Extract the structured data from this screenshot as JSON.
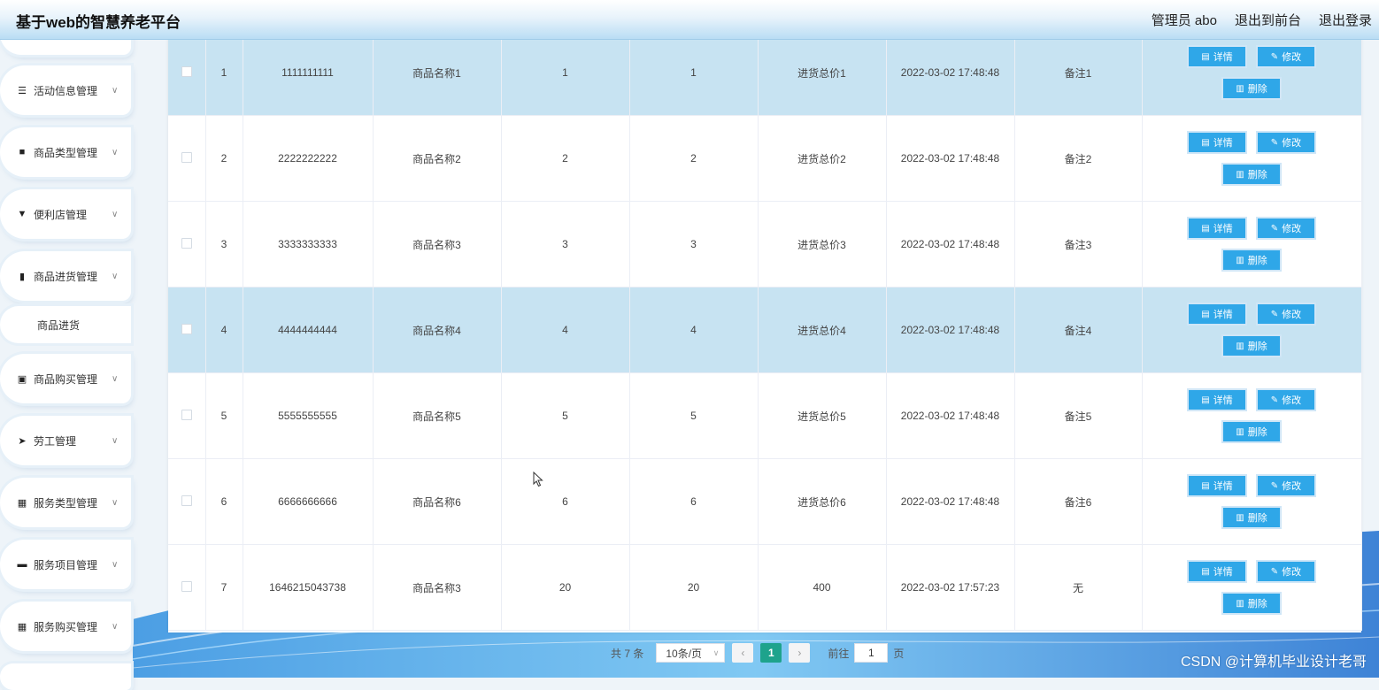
{
  "header": {
    "title": "基于web的智慧养老平台",
    "admin": "管理员 abo",
    "back_front": "退出到前台",
    "logout": "退出登录"
  },
  "sidebar": {
    "items": [
      {
        "label": "活动信息管理",
        "icon": "sliders-icon"
      },
      {
        "label": "商品类型管理",
        "icon": "video-icon"
      },
      {
        "label": "便利店管理",
        "icon": "shop-icon"
      },
      {
        "label": "商品进货管理",
        "icon": "chart-icon"
      },
      {
        "label": "商品购买管理",
        "icon": "clipboard-icon"
      },
      {
        "label": "劳工管理",
        "icon": "send-icon"
      },
      {
        "label": "服务类型管理",
        "icon": "grid-icon"
      },
      {
        "label": "服务项目管理",
        "icon": "monitor-icon"
      },
      {
        "label": "服务购买管理",
        "icon": "grid-icon"
      }
    ],
    "submenu": {
      "label": "商品进货"
    }
  },
  "table": {
    "rows": [
      {
        "idx": "1",
        "code": "1111111111",
        "name": "商品名称1",
        "qty": "1",
        "price": "1",
        "total": "进货总价1",
        "time": "2022-03-02 17:48:48",
        "remark": "备注1",
        "highlight": true
      },
      {
        "idx": "2",
        "code": "2222222222",
        "name": "商品名称2",
        "qty": "2",
        "price": "2",
        "total": "进货总价2",
        "time": "2022-03-02 17:48:48",
        "remark": "备注2",
        "highlight": false
      },
      {
        "idx": "3",
        "code": "3333333333",
        "name": "商品名称3",
        "qty": "3",
        "price": "3",
        "total": "进货总价3",
        "time": "2022-03-02 17:48:48",
        "remark": "备注3",
        "highlight": false
      },
      {
        "idx": "4",
        "code": "4444444444",
        "name": "商品名称4",
        "qty": "4",
        "price": "4",
        "total": "进货总价4",
        "time": "2022-03-02 17:48:48",
        "remark": "备注4",
        "highlight": true
      },
      {
        "idx": "5",
        "code": "5555555555",
        "name": "商品名称5",
        "qty": "5",
        "price": "5",
        "total": "进货总价5",
        "time": "2022-03-02 17:48:48",
        "remark": "备注5",
        "highlight": false
      },
      {
        "idx": "6",
        "code": "6666666666",
        "name": "商品名称6",
        "qty": "6",
        "price": "6",
        "total": "进货总价6",
        "time": "2022-03-02 17:48:48",
        "remark": "备注6",
        "highlight": false
      },
      {
        "idx": "7",
        "code": "1646215043738",
        "name": "商品名称3",
        "qty": "20",
        "price": "20",
        "total": "400",
        "time": "2022-03-02 17:57:23",
        "remark": "无",
        "highlight": false
      }
    ],
    "buttons": {
      "detail": "详情",
      "edit": "修改",
      "delete": "删除"
    }
  },
  "pager": {
    "total": "共 7 条",
    "size": "10条/页",
    "current": "1",
    "goto": "前往",
    "goto_value": "1",
    "page_unit": "页"
  },
  "watermark": "CSDN @计算机毕业设计老哥",
  "colors": {
    "accent": "#2fa7e8",
    "active_page": "#1ea38c",
    "row_highlight": "#c7e3f2"
  }
}
